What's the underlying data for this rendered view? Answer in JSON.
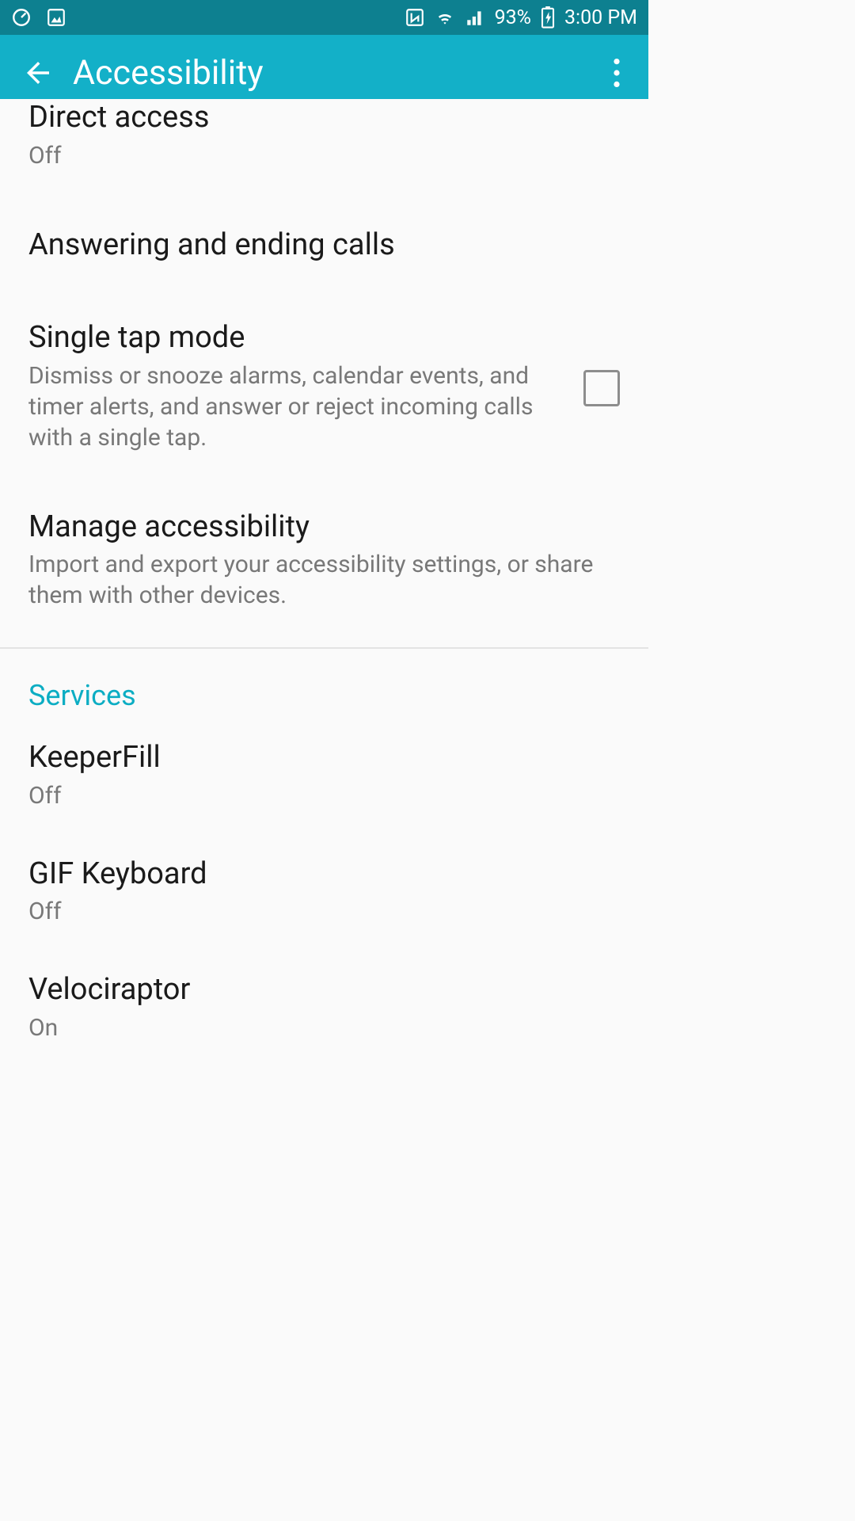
{
  "status": {
    "battery": "93%",
    "time": "3:00 PM"
  },
  "actionbar": {
    "title": "Accessibility"
  },
  "settings": {
    "direct_access": {
      "title": "Direct access",
      "sub": "Off"
    },
    "answering": {
      "title": "Answering and ending calls"
    },
    "single_tap": {
      "title": "Single tap mode",
      "sub": "Dismiss or snooze alarms, calendar events, and timer alerts, and answer or reject incoming calls with a single tap."
    },
    "manage": {
      "title": "Manage accessibility",
      "sub": "Import and export your accessibility settings, or share them with other devices."
    }
  },
  "services": {
    "header": "Services",
    "items": [
      {
        "title": "KeeperFill",
        "sub": "Off"
      },
      {
        "title": "GIF Keyboard",
        "sub": "Off"
      },
      {
        "title": "Velociraptor",
        "sub": "On"
      }
    ]
  }
}
